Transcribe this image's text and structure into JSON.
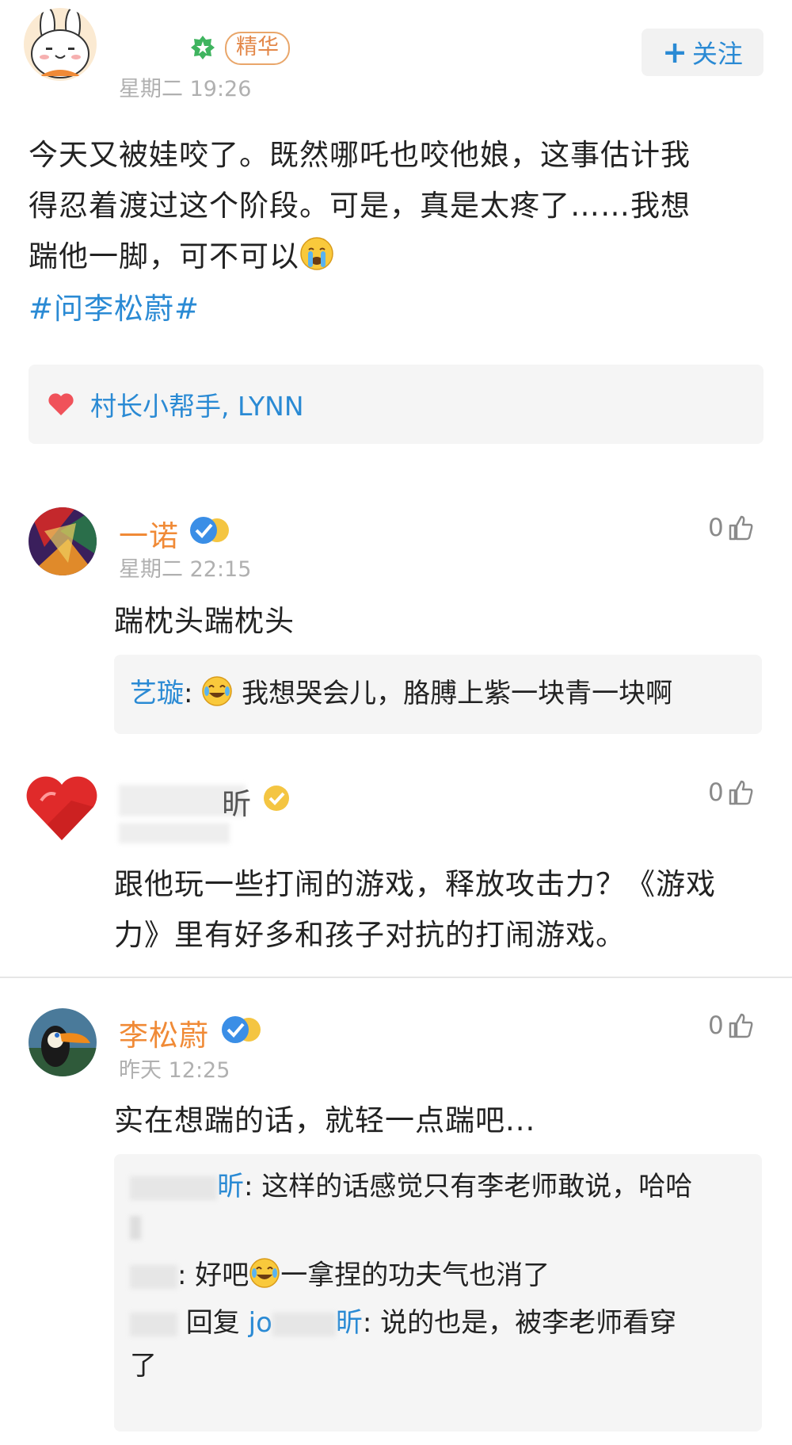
{
  "post": {
    "author": "",
    "tag": "精华",
    "time": "星期二 19:26",
    "follow_label": "关注",
    "follow_prefix": "+",
    "lines": [
      "今天又被娃咬了。既然哪吒也咬他娘，这事估计我",
      "得忍着渡过这个阶段。可是，真是太疼了……我想",
      "踹他一脚，可不可以"
    ],
    "hashtag": "#问李松蔚#",
    "likes_names": "村长小帮手, LYNN"
  },
  "comments": [
    {
      "name": "一诺",
      "time": "星期二 22:15",
      "likes": "0",
      "text_lines": [
        "踹枕头踹枕头"
      ],
      "replies": [
        {
          "name": "艺璇",
          "sep": ":",
          "text": "我想哭会儿，胳膊上紫一块青一块啊"
        }
      ]
    },
    {
      "name": "昕",
      "time": "",
      "likes": "0",
      "text_lines": [
        "跟他玩一些打闹的游戏，释放攻击力？《游戏",
        "力》里有好多和孩子对抗的打闹游戏。"
      ],
      "replies": []
    },
    {
      "name": "李松蔚",
      "time": "昨天 12:25",
      "likes": "0",
      "text_lines": [
        "实在想踹的话，就轻一点踹吧..."
      ],
      "replies": [
        {
          "name_tail": "昕",
          "sep": ":",
          "text": "这样的话感觉只有李老师敢说，哈哈"
        },
        {
          "sep": ":",
          "text_a": "好吧",
          "text_b": "一拿捏的功夫气也消了"
        },
        {
          "action": "回复",
          "target_head": "jo",
          "target_tail": "昕",
          "sep": ":",
          "text": "说的也是，被李老师看穿",
          "text_cont": "了"
        }
      ]
    }
  ],
  "colors": {
    "accent_blue": "#2a8ad4",
    "username_orange": "#f08a36",
    "verified_blue": "#3a8ee6",
    "verified_gold": "#f4c542",
    "heart_red": "#f0525a"
  },
  "icons": [
    "bunny-avatar-icon",
    "vip-badge-icon",
    "heart-icon",
    "verified-badge-icon",
    "thumbs-up-icon",
    "crying-emoji-icon",
    "laugh-cry-emoji-icon",
    "toucan-avatar-icon",
    "abstract-avatar-icon",
    "red-heart-avatar-icon"
  ]
}
